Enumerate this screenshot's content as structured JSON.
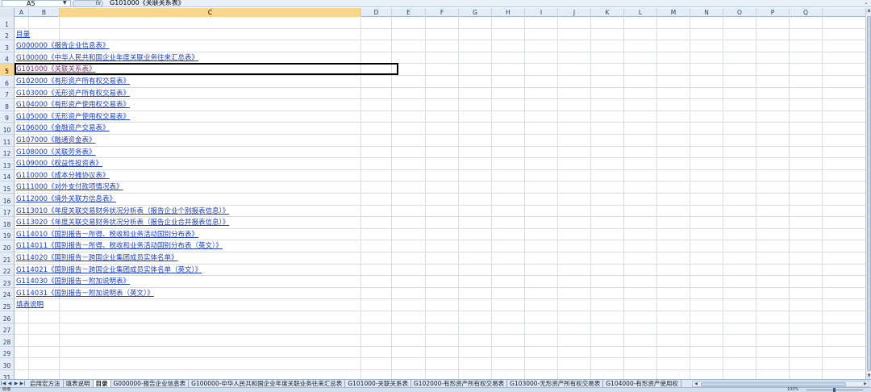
{
  "formula_bar": {
    "name_box": "A5",
    "fx": "fx",
    "formula": "G101000《关联关系表》"
  },
  "columns": [
    "A",
    "B",
    "C",
    "D",
    "E",
    "F",
    "G",
    "H",
    "I",
    "J",
    "K",
    "L",
    "M",
    "N",
    "O",
    "P",
    "Q"
  ],
  "selected_column": "C",
  "rows": [
    "1",
    "2",
    "3",
    "4",
    "5",
    "6",
    "7",
    "8",
    "9",
    "10",
    "11",
    "12",
    "13",
    "14",
    "15",
    "16",
    "17",
    "18",
    "19",
    "20",
    "21",
    "22",
    "23",
    "24",
    "25",
    "26",
    "27",
    "28",
    "29",
    "30",
    "31"
  ],
  "selected_row": "5",
  "cells": [
    {
      "row": "2",
      "text": "目录",
      "visited": false
    },
    {
      "row": "3",
      "text": "G000000《报告企业信息表》",
      "visited": false
    },
    {
      "row": "4",
      "text": "G100000《中华人民共和国企业年度关联业务往来汇总表》",
      "visited": false
    },
    {
      "row": "5",
      "text": "G101000《关联关系表》",
      "visited": true
    },
    {
      "row": "6",
      "text": "G102000《有形资产所有权交易表》",
      "visited": false
    },
    {
      "row": "7",
      "text": "G103000《无形资产所有权交易表》",
      "visited": false
    },
    {
      "row": "8",
      "text": "G104000《有形资产使用权交易表》",
      "visited": false
    },
    {
      "row": "9",
      "text": "G105000《无形资产使用权交易表》",
      "visited": false
    },
    {
      "row": "10",
      "text": "G106000《金融资产交易表》",
      "visited": false
    },
    {
      "row": "11",
      "text": "G107000《融通资金表》",
      "visited": false
    },
    {
      "row": "12",
      "text": "G108000《关联劳务表》",
      "visited": false
    },
    {
      "row": "13",
      "text": "G109000《权益性投资表》",
      "visited": false
    },
    {
      "row": "14",
      "text": "G110000《成本分摊协议表》",
      "visited": false
    },
    {
      "row": "15",
      "text": "G111000《对外支付款项情况表》",
      "visited": false
    },
    {
      "row": "16",
      "text": "G112000《境外关联方信息表》",
      "visited": false
    },
    {
      "row": "17",
      "text": "G113010《年度关联交易财务状况分析表（报告企业个别报表信息）》",
      "visited": false
    },
    {
      "row": "18",
      "text": "G113020《年度关联交易财务状况分析表（报告企业合并报表信息）》",
      "visited": false
    },
    {
      "row": "19",
      "text": "G114010《国别报告－所得、税收和业务活动国别分布表》",
      "visited": false
    },
    {
      "row": "20",
      "text": "G114011《国别报告－所得、税收和业务活动国别分布表（英文）》",
      "visited": false
    },
    {
      "row": "21",
      "text": "G114020《国别报告－跨国企业集团成员实体名单》",
      "visited": false
    },
    {
      "row": "22",
      "text": "G114021《国别报告－跨国企业集团成员实体名单（英文）》",
      "visited": false
    },
    {
      "row": "23",
      "text": "G114030《国别报告－附加说明表》",
      "visited": false
    },
    {
      "row": "24",
      "text": "G114031《国别报告－附加说明表（英文）》",
      "visited": false
    },
    {
      "row": "25",
      "text": "填表说明",
      "visited": false
    }
  ],
  "sheet_tabs": [
    {
      "label": "启用宏方法",
      "active": false
    },
    {
      "label": "填表说明",
      "active": false
    },
    {
      "label": "目录",
      "active": true
    },
    {
      "label": "G000000-报告企业信息表",
      "active": false
    },
    {
      "label": "G100000-中华人民共和国企业年度关联业务往来汇总表",
      "active": false
    },
    {
      "label": "G101000-关联关系表",
      "active": false
    },
    {
      "label": "G102000-有形资产所有权交易表",
      "active": false
    },
    {
      "label": "G103000-无形资产所有权交易表",
      "active": false
    },
    {
      "label": "G104000-有形资产使用权",
      "active": false
    }
  ],
  "status_bar": {
    "text": "就绪",
    "zoom": "100%"
  }
}
